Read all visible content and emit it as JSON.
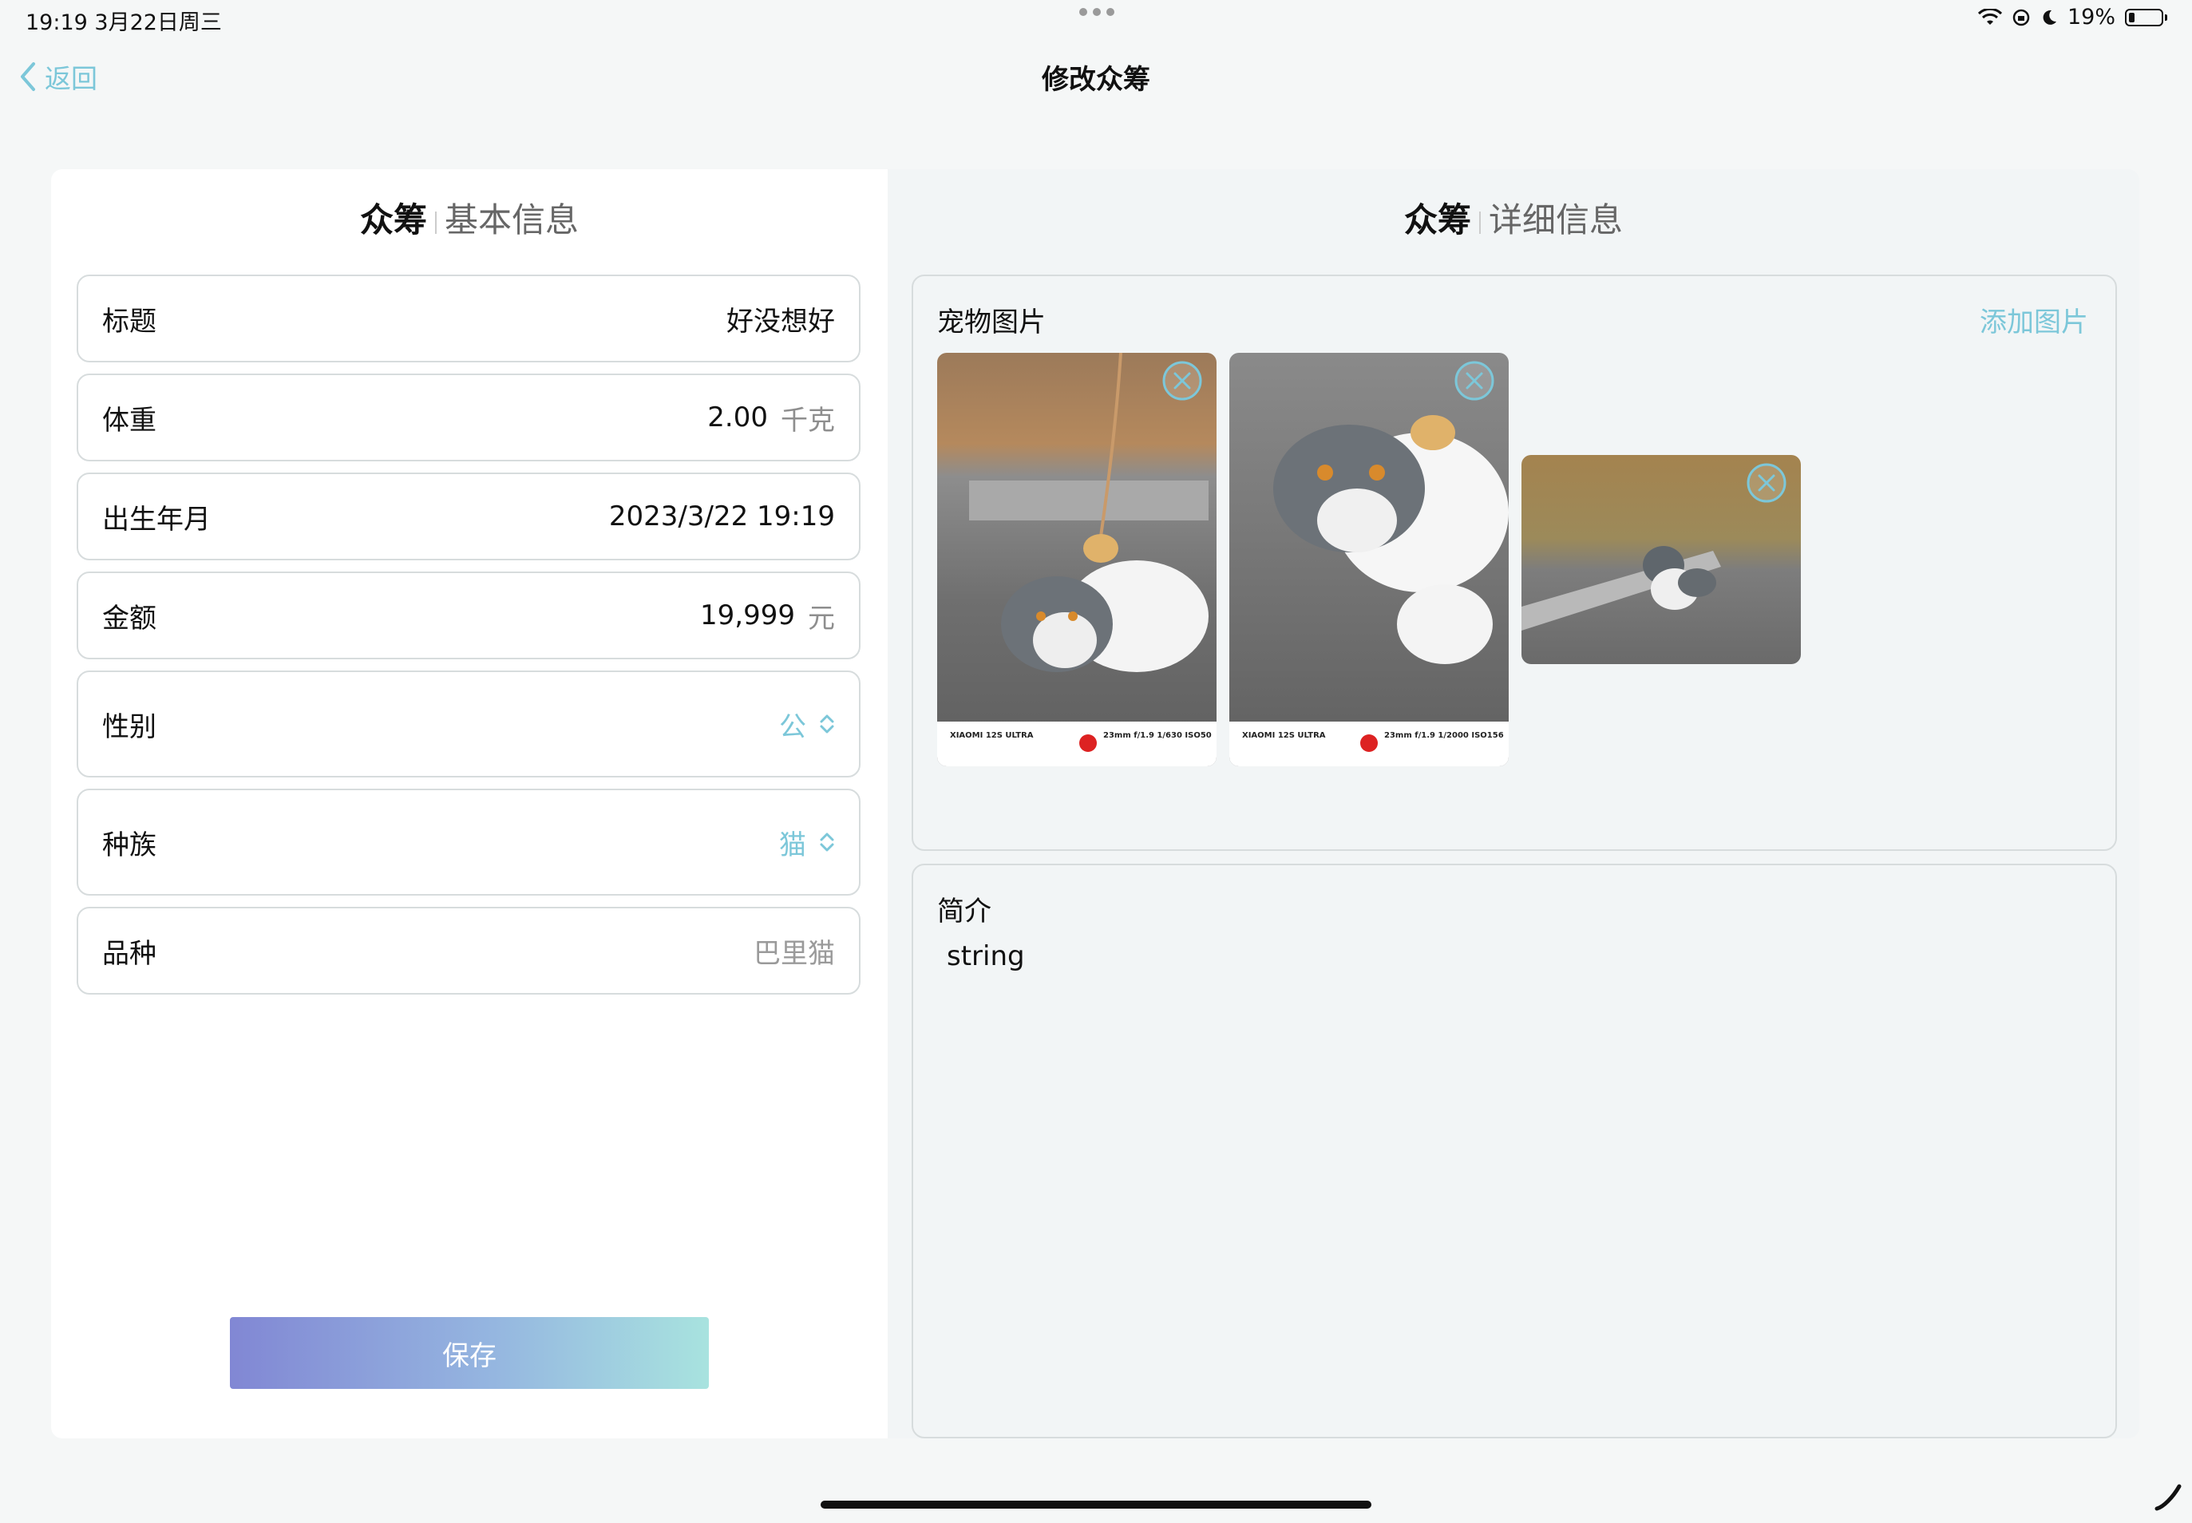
{
  "status_bar": {
    "time_date": "19:19   3月22日周三",
    "battery": "19%"
  },
  "nav": {
    "back_label": "返回",
    "title": "修改众筹"
  },
  "basic_panel": {
    "title_bold": "众筹",
    "title_light": "基本信息",
    "fields": {
      "title": {
        "label": "标题",
        "value": "好没想好"
      },
      "weight": {
        "label": "体重",
        "value": "2.00",
        "unit": "千克"
      },
      "birth": {
        "label": "出生年月",
        "value": "2023/3/22 19:19"
      },
      "amount": {
        "label": "金额",
        "value": "19,999",
        "unit": "元"
      },
      "gender": {
        "label": "性别",
        "value": "公"
      },
      "species": {
        "label": "种族",
        "value": "猫"
      },
      "breed": {
        "label": "品种",
        "placeholder": "巴里猫"
      }
    },
    "save_label": "保存"
  },
  "detail_panel": {
    "title_bold": "众筹",
    "title_light": "详细信息",
    "photos": {
      "label": "宠物图片",
      "add_label": "添加图片",
      "items": [
        {
          "camera": "XIAOMI 12S ULTRA",
          "exif": "23mm  f/1.9  1/630  ISO50"
        },
        {
          "camera": "XIAOMI 12S ULTRA",
          "exif": "23mm  f/1.9  1/2000  ISO156"
        },
        {
          "camera": "",
          "exif": ""
        }
      ]
    },
    "intro": {
      "label": "简介",
      "text": "string"
    }
  },
  "colors": {
    "accent": "#7cc7d9",
    "gradient_start": "#8187d4",
    "gradient_end": "#a8e3df"
  }
}
